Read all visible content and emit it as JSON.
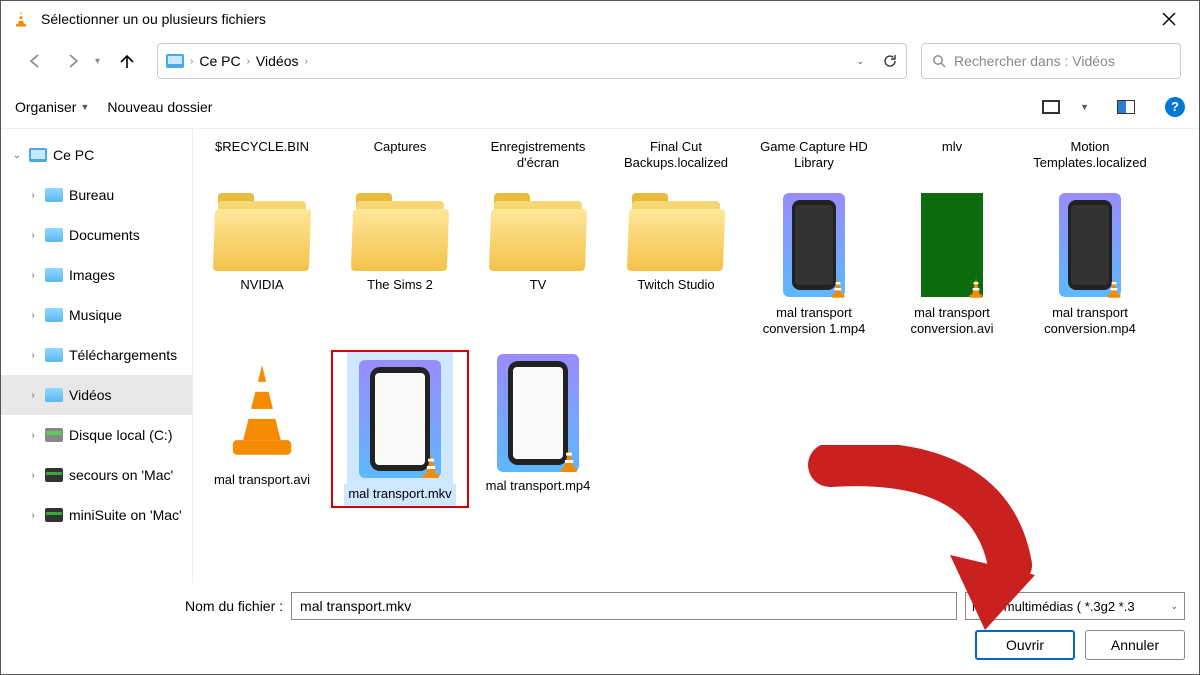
{
  "titlebar": {
    "title": "Sélectionner un ou plusieurs fichiers"
  },
  "breadcrumb": {
    "item1": "Ce PC",
    "item2": "Vidéos"
  },
  "search": {
    "placeholder": "Rechercher dans : Vidéos"
  },
  "toolbar": {
    "organize": "Organiser",
    "new_folder": "Nouveau dossier"
  },
  "sidebar": {
    "root": "Ce PC",
    "items": [
      {
        "label": "Bureau",
        "type": "folder"
      },
      {
        "label": "Documents",
        "type": "folder"
      },
      {
        "label": "Images",
        "type": "folder"
      },
      {
        "label": "Musique",
        "type": "folder"
      },
      {
        "label": "Téléchargements",
        "type": "folder"
      },
      {
        "label": "Vidéos",
        "type": "folder",
        "selected": true
      },
      {
        "label": "Disque local (C:)",
        "type": "drive"
      },
      {
        "label": "secours on 'Mac'",
        "type": "netdrive"
      },
      {
        "label": "miniSuite on 'Mac'",
        "type": "netdrive"
      }
    ]
  },
  "folders_top_labels": {
    "f1": "$RECYCLE.BIN",
    "f2": "Captures",
    "f3": "Enregistrements d'écran",
    "f4": "Final Cut Backups.localized",
    "f5": "Game Capture HD Library",
    "f6": "mlv",
    "f7": "Motion Templates.localized"
  },
  "folders_mid_labels": {
    "f1": "NVIDIA",
    "f2": "The Sims 2",
    "f3": "TV",
    "f4": "Twitch Studio"
  },
  "video_labels": {
    "v1": "mal transport conversion 1.mp4",
    "v2": "mal transport conversion.avi",
    "v3": "mal transport conversion.mp4",
    "v4": "mal transport.avi",
    "v5": "mal transport.mkv",
    "v6": "mal transport.mp4"
  },
  "filename_field": {
    "label": "Nom du fichier :",
    "value": "mal transport.mkv"
  },
  "filetype": {
    "label": "hiers multimédias ( *.3g2 *.3"
  },
  "buttons": {
    "open": "Ouvrir",
    "cancel": "Annuler"
  }
}
